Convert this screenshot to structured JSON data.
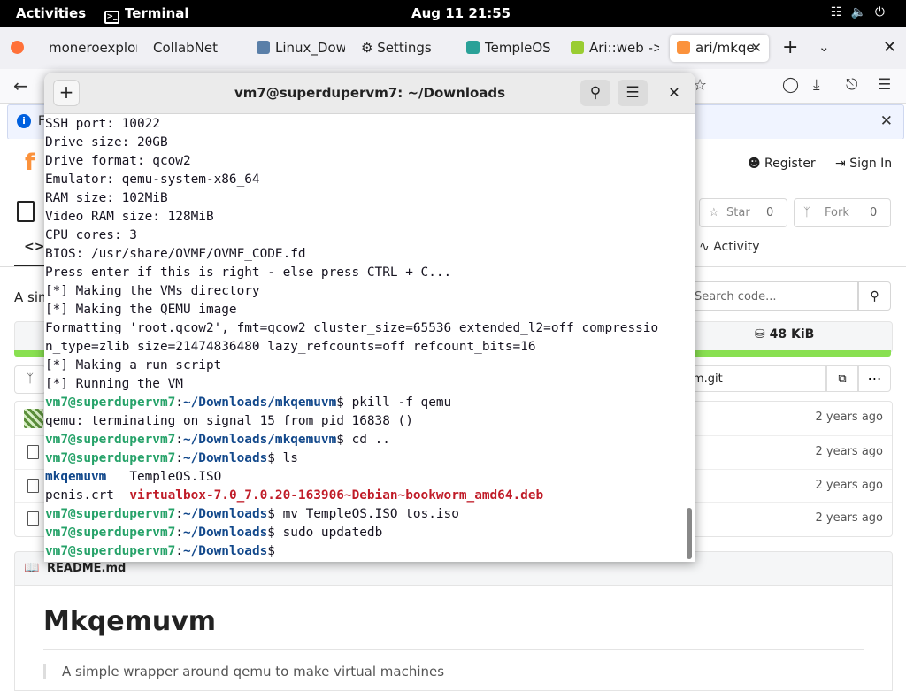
{
  "topbar": {
    "activities": "Activities",
    "app_name": "Terminal",
    "clock": "Aug 11  21:55",
    "tray_icons": [
      "network-icon",
      "volume-icon",
      "power-icon"
    ]
  },
  "browser": {
    "tabs": [
      {
        "label": "moneroexplor",
        "icon": "firefox-icon"
      },
      {
        "label": "CollabNet",
        "icon": ""
      },
      {
        "label": "Linux_Dow",
        "icon": "document-icon"
      },
      {
        "label": "Settings",
        "icon": "gear-icon"
      },
      {
        "label": "TempleOS",
        "icon": "templeos-icon"
      },
      {
        "label": "Ari::web ->",
        "icon": "bug-icon"
      },
      {
        "label": "ari/mkqe",
        "icon": "forgejo-icon",
        "active": true
      }
    ],
    "infobar_text": "F",
    "accent": "#0060df"
  },
  "page": {
    "register": "Register",
    "signin": "Sign In",
    "star_label": "Star",
    "star_count": "0",
    "fork_label": "Fork",
    "fork_count": "0",
    "activity_tab": "Activity",
    "description": "A sim",
    "search_placeholder": "Search code...",
    "repo_size": "48 KiB",
    "clone_url": "m.git",
    "file_times": [
      "2 years ago",
      "2 years ago",
      "2 years ago",
      "2 years ago"
    ],
    "readme_label": "README.md",
    "readme_title": "Mkqemuvm",
    "readme_quote": "A simple wrapper around qemu to make virtual machines",
    "lang_color": "#89e051"
  },
  "terminal": {
    "title": "vm7@superdupervm7: ~/Downloads",
    "prompt_user": "vm7@superdupervm7",
    "output_lines": [
      "SSH port: 10022",
      "Drive size: 20GB",
      "Drive format: qcow2",
      "Emulator: qemu-system-x86_64",
      "RAM size: 102MiB",
      "Video RAM size: 128MiB",
      "CPU cores: 3",
      "BIOS: /usr/share/OVMF/OVMF_CODE.fd",
      "Press enter if this is right - else press CTRL + C...",
      "[*] Making the VMs directory",
      "[*] Making the QEMU image",
      "Formatting 'root.qcow2', fmt=qcow2 cluster_size=65536 extended_l2=off compressio",
      "n_type=zlib size=21474836480 lazy_refcounts=off refcount_bits=16",
      "[*] Making a run script",
      "[*] Running the VM"
    ],
    "cmd1_path": "~/Downloads/mkqemuvm",
    "cmd1": " pkill -f qemu",
    "out1": "qemu: terminating on signal 15 from pid 16838 ()",
    "cmd2_path": "~/Downloads/mkqemuvm",
    "cmd2": " cd ..",
    "cmd3_path": "~/Downloads",
    "cmd3": " ls",
    "ls_dir": "mkqemuvm",
    "ls_file1": "TempleOS.ISO",
    "ls_file2": "penis.crt",
    "ls_deb": "virtualbox-7.0_7.0.20-163906~Debian~bookworm_amd64.deb",
    "cmd4_path": "~/Downloads",
    "cmd4": " mv TempleOS.ISO tos.iso",
    "cmd5_path": "~/Downloads",
    "cmd5": " sudo updatedb",
    "cmd6_path": "~/Downloads",
    "colors": {
      "user": "#26a269",
      "path": "#12488b",
      "archive": "#c01c28"
    }
  }
}
